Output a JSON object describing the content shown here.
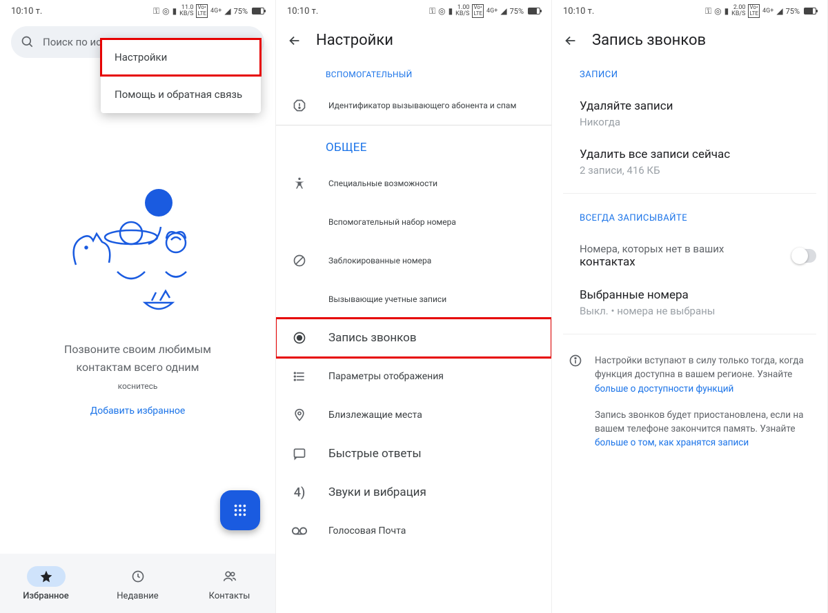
{
  "status": {
    "time": "10:10 т.",
    "net1_speed": "11.0",
    "net2_speed": "1.00",
    "net3_speed": "2.00",
    "kbs_label": "KB/S",
    "lte_label": "LTE",
    "sig_label": "4G+",
    "battery_pct": "75%"
  },
  "screen1": {
    "search_placeholder": "Поиск по истории звонков",
    "popup": {
      "settings": "Настройки",
      "help": "Помощь и обратная связь"
    },
    "hero_line1": "Позвоните своим любимым",
    "hero_line2": "контактам всего одним",
    "hero_line3": "коснитесь",
    "add_favorite": "Добавить избранное",
    "nav": {
      "favorites": "Избранное",
      "recents": "Недавние",
      "contacts": "Контакты"
    }
  },
  "screen2": {
    "title": "Настройки",
    "section_aux": "ВСПОМОГАТЕЛЬНЫЙ",
    "caller_id": "Идентификатор вызывающего абонента и спам",
    "section_general": "ОБЩЕЕ",
    "accessibility": "Специальные возможности",
    "assisted_dial": "Вспомогательный набор номера",
    "blocked": "Заблокированные номера",
    "calling_accounts": "Вызывающие учетные записи",
    "call_recording": "Запись звонков",
    "display_options": "Параметры отображения",
    "nearby": "Близлежащие места",
    "quick_replies": "Быстрые ответы",
    "sounds": "Звуки и вибрация",
    "voicemail": "Голосовая Почта"
  },
  "screen3": {
    "title": "Запись звонков",
    "section_records": "ЗАПИСИ",
    "delete_records": "Удаляйте записи",
    "delete_records_sub": "Никогда",
    "delete_all": "Удалить все записи сейчас",
    "delete_all_sub": "2 записи, 416 КБ",
    "section_always": "ВСЕГДА ЗАПИСЫВАЙТЕ",
    "unknown_numbers_l1": "Номера, которых нет в ваших",
    "unknown_numbers_l2": "контактах",
    "selected_numbers": "Выбранные номера",
    "selected_numbers_sub": "Выкл. • номера не выбраны",
    "info1_l1": "Настройки вступают в силу только тогда, когда",
    "info1_l2": "функция доступна в вашем регионе. Узнайте",
    "info1_link": "больше о доступности функций",
    "info2_l1": "Запись звонков будет приостановлена, если на",
    "info2_l2": "вашем телефоне закончится память. Узнайте",
    "info2_link": "больше о том, как хранятся записи"
  }
}
